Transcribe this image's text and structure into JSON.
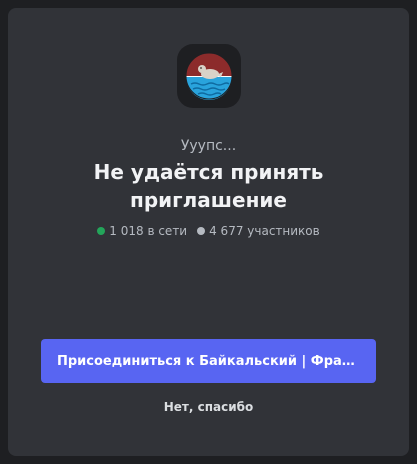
{
  "subtitle": "Ууупс...",
  "title": "Не удаётся принять приглашение",
  "stats": {
    "online_text": "1 018 в сети",
    "members_text": "4 677 участников"
  },
  "colors": {
    "accent": "#5865f2",
    "online": "#23a55a",
    "members": "#b5bac1"
  },
  "join_button": {
    "label": "Присоединиться к Байкальский | Фракц..."
  },
  "decline_link": {
    "label": "Нет, спасибо"
  },
  "server_icon": "seal-on-water-icon"
}
